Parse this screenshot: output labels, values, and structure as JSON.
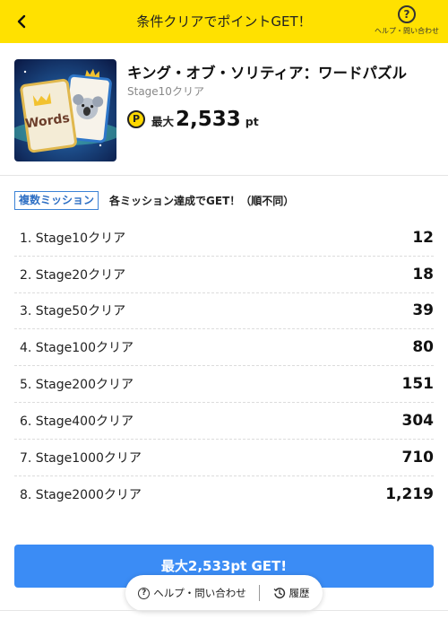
{
  "header": {
    "title": "条件クリアでポイントGET！",
    "help_label": "ヘルプ・問い合わせ",
    "help_symbol": "?"
  },
  "app": {
    "name": "キング・オブ・ソリティア：ワードパズル",
    "subtitle": "Stage10クリア",
    "icon_text": "Words",
    "points_icon": "P",
    "points_prefix": "最大",
    "points_value": "2,533",
    "points_unit": "pt"
  },
  "mission": {
    "badge": "複数ミッション",
    "description": "各ミッション達成でGET！（順不同）",
    "items": [
      {
        "label": "1. Stage10クリア",
        "points": "12"
      },
      {
        "label": "2. Stage20クリア",
        "points": "18"
      },
      {
        "label": "3. Stage50クリア",
        "points": "39"
      },
      {
        "label": "4. Stage100クリア",
        "points": "80"
      },
      {
        "label": "5. Stage200クリア",
        "points": "151"
      },
      {
        "label": "6. Stage400クリア",
        "points": "304"
      },
      {
        "label": "7. Stage1000クリア",
        "points": "710"
      },
      {
        "label": "8. Stage2000クリア",
        "points": "1,219"
      }
    ]
  },
  "cta": {
    "label": "最大2,533pt GET!"
  },
  "bottom_bar": {
    "help_symbol": "?",
    "help_label": "ヘルプ・問い合わせ",
    "history_label": "履歴"
  },
  "colors": {
    "header_bg": "#ffe100",
    "accent_blue": "#3b8cf5",
    "badge_blue": "#2e6fc4",
    "point_yellow": "#ffd800"
  },
  "icons": {
    "back": "chevron-left-icon",
    "help": "question-circle-icon",
    "points": "point-coin-icon",
    "history": "history-clock-icon"
  }
}
